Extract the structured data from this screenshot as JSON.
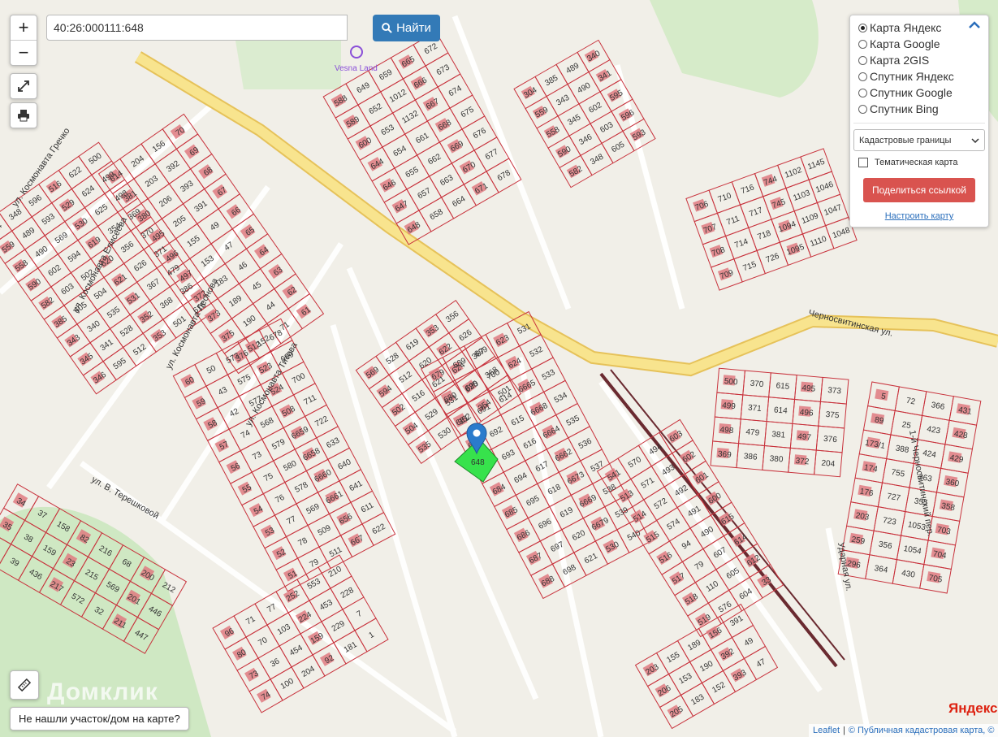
{
  "search": {
    "value": "40:26:000111:648",
    "button_label": "Найти"
  },
  "map": {
    "poi_label": "Vesna Land",
    "streets": [
      "ул. Космонавта Гречко",
      "ул. Космонавта Елисеева",
      "ул. Космонавта Леонова",
      "ул. Космонавта Титова",
      "ул. В. Терешковой",
      "Черносвитинская ул.",
      "1-й Черносвитинский пер.",
      "Ударная ул."
    ],
    "parcels": [
      "304",
      "559",
      "558",
      "590",
      "582",
      "385",
      "343",
      "345",
      "346",
      "348",
      "489",
      "490",
      "602",
      "603",
      "605",
      "340",
      "341",
      "595",
      "596",
      "593",
      "569",
      "594",
      "502",
      "504",
      "535",
      "528",
      "512",
      "516",
      "529",
      "530",
      "619",
      "620",
      "621",
      "531",
      "352",
      "353",
      "622",
      "624",
      "625",
      "354",
      "356",
      "626",
      "367",
      "368",
      "501",
      "500",
      "499",
      "498",
      "369",
      "370",
      "371",
      "479",
      "386",
      "615",
      "614",
      "381",
      "380",
      "495",
      "496",
      "497",
      "372",
      "373",
      "375",
      "376",
      "204",
      "203",
      "206",
      "205",
      "155",
      "153",
      "183",
      "189",
      "190",
      "152",
      "156",
      "392",
      "393",
      "391",
      "49",
      "47",
      "46",
      "45",
      "44",
      "71",
      "70",
      "69",
      "68",
      "67",
      "66",
      "65",
      "64",
      "63",
      "62",
      "61",
      "60",
      "59",
      "58",
      "57",
      "56",
      "55",
      "54",
      "53",
      "52",
      "51",
      "50",
      "43",
      "42",
      "74",
      "73",
      "75",
      "76",
      "77",
      "78",
      "79",
      "573",
      "575",
      "577",
      "568",
      "579",
      "580",
      "578",
      "569",
      "509",
      "511",
      "512",
      "523",
      "524",
      "508",
      "6659",
      "6658",
      "6660",
      "6661",
      "656",
      "667",
      "678",
      "689",
      "700",
      "711",
      "722",
      "633",
      "640",
      "641",
      "611",
      "622",
      "588",
      "589",
      "600",
      "644",
      "646",
      "647",
      "648",
      "649",
      "652",
      "653",
      "654",
      "655",
      "657",
      "658",
      "659",
      "1012",
      "1132",
      "661",
      "662",
      "663",
      "664",
      "665",
      "666",
      "667",
      "668",
      "669",
      "670",
      "671",
      "672",
      "673",
      "674",
      "675",
      "676",
      "677",
      "678",
      "679",
      "680",
      "681",
      "682",
      "683",
      "684",
      "685",
      "686",
      "687",
      "688",
      "689",
      "690",
      "691",
      "692",
      "693",
      "694",
      "695",
      "696",
      "697",
      "698",
      "699",
      "700",
      "614",
      "615",
      "616",
      "617",
      "618",
      "619",
      "620",
      "621",
      "623",
      "624",
      "6665",
      "6668",
      "6664",
      "6662",
      "6673",
      "6669",
      "6679",
      "530",
      "531",
      "532",
      "533",
      "534",
      "535",
      "536",
      "537",
      "538",
      "539",
      "540",
      "541",
      "513",
      "514",
      "515",
      "516",
      "517",
      "518",
      "519",
      "570",
      "571",
      "572",
      "574",
      "94",
      "79",
      "110",
      "576",
      "494",
      "493",
      "492",
      "491",
      "490",
      "607",
      "605",
      "604",
      "603",
      "602",
      "601",
      "600",
      "615",
      "614",
      "612",
      "33",
      "34",
      "35",
      "36",
      "37",
      "38",
      "39",
      "158",
      "159",
      "436",
      "82",
      "23",
      "217",
      "216",
      "215",
      "572",
      "68",
      "569",
      "32",
      "200",
      "201",
      "211",
      "212",
      "446",
      "447",
      "96",
      "80",
      "73",
      "74",
      "71",
      "70",
      "36",
      "100",
      "77",
      "103",
      "454",
      "204",
      "252",
      "224",
      "159",
      "92",
      "553",
      "453",
      "229",
      "181",
      "210",
      "228",
      "7",
      "1",
      "5",
      "89",
      "173/1",
      "174",
      "176",
      "203",
      "259",
      "296",
      "72",
      "25",
      "388",
      "755",
      "727",
      "723",
      "356",
      "364",
      "366",
      "423",
      "424",
      "363",
      "355",
      "1053",
      "1054",
      "430",
      "431",
      "428",
      "429",
      "360",
      "358",
      "703",
      "704",
      "705",
      "706",
      "707",
      "708",
      "709",
      "710",
      "711",
      "714",
      "715",
      "716",
      "717",
      "718",
      "726",
      "744",
      "745",
      "1094",
      "1095",
      "1102",
      "1103",
      "1109",
      "1110",
      "1145",
      "1046",
      "1047",
      "1048"
    ]
  },
  "selected_parcel": "648",
  "layers_panel": {
    "base_layers": [
      {
        "label": "Карта Яндекс",
        "selected": true
      },
      {
        "label": "Карта Google",
        "selected": false
      },
      {
        "label": "Карта 2GIS",
        "selected": false
      },
      {
        "label": "Спутник Яндекс",
        "selected": false
      },
      {
        "label": "Спутник Google",
        "selected": false
      },
      {
        "label": "Спутник Bing",
        "selected": false
      }
    ],
    "overlay_select": "Кадастровые границы",
    "thematic_label": "Тематическая карта",
    "thematic_checked": false,
    "share_label": "Поделиться ссылкой",
    "configure_label": "Настроить карту"
  },
  "footer": {
    "not_found_label": "Не нашли участок/дом на карте?",
    "watermark": "Домклик",
    "yandex_logo": "Яндекс",
    "attribution_leaflet": "Leaflet",
    "attribution_sep": "|",
    "attribution_source": "© Публичная кадастровая карта, ©"
  },
  "colors": {
    "parcel_line": "#c8323c",
    "main_road": "#f5d66b",
    "building": "#e07a80",
    "selected_parcel": "#37e24c",
    "marker": "#2b7bcc"
  }
}
